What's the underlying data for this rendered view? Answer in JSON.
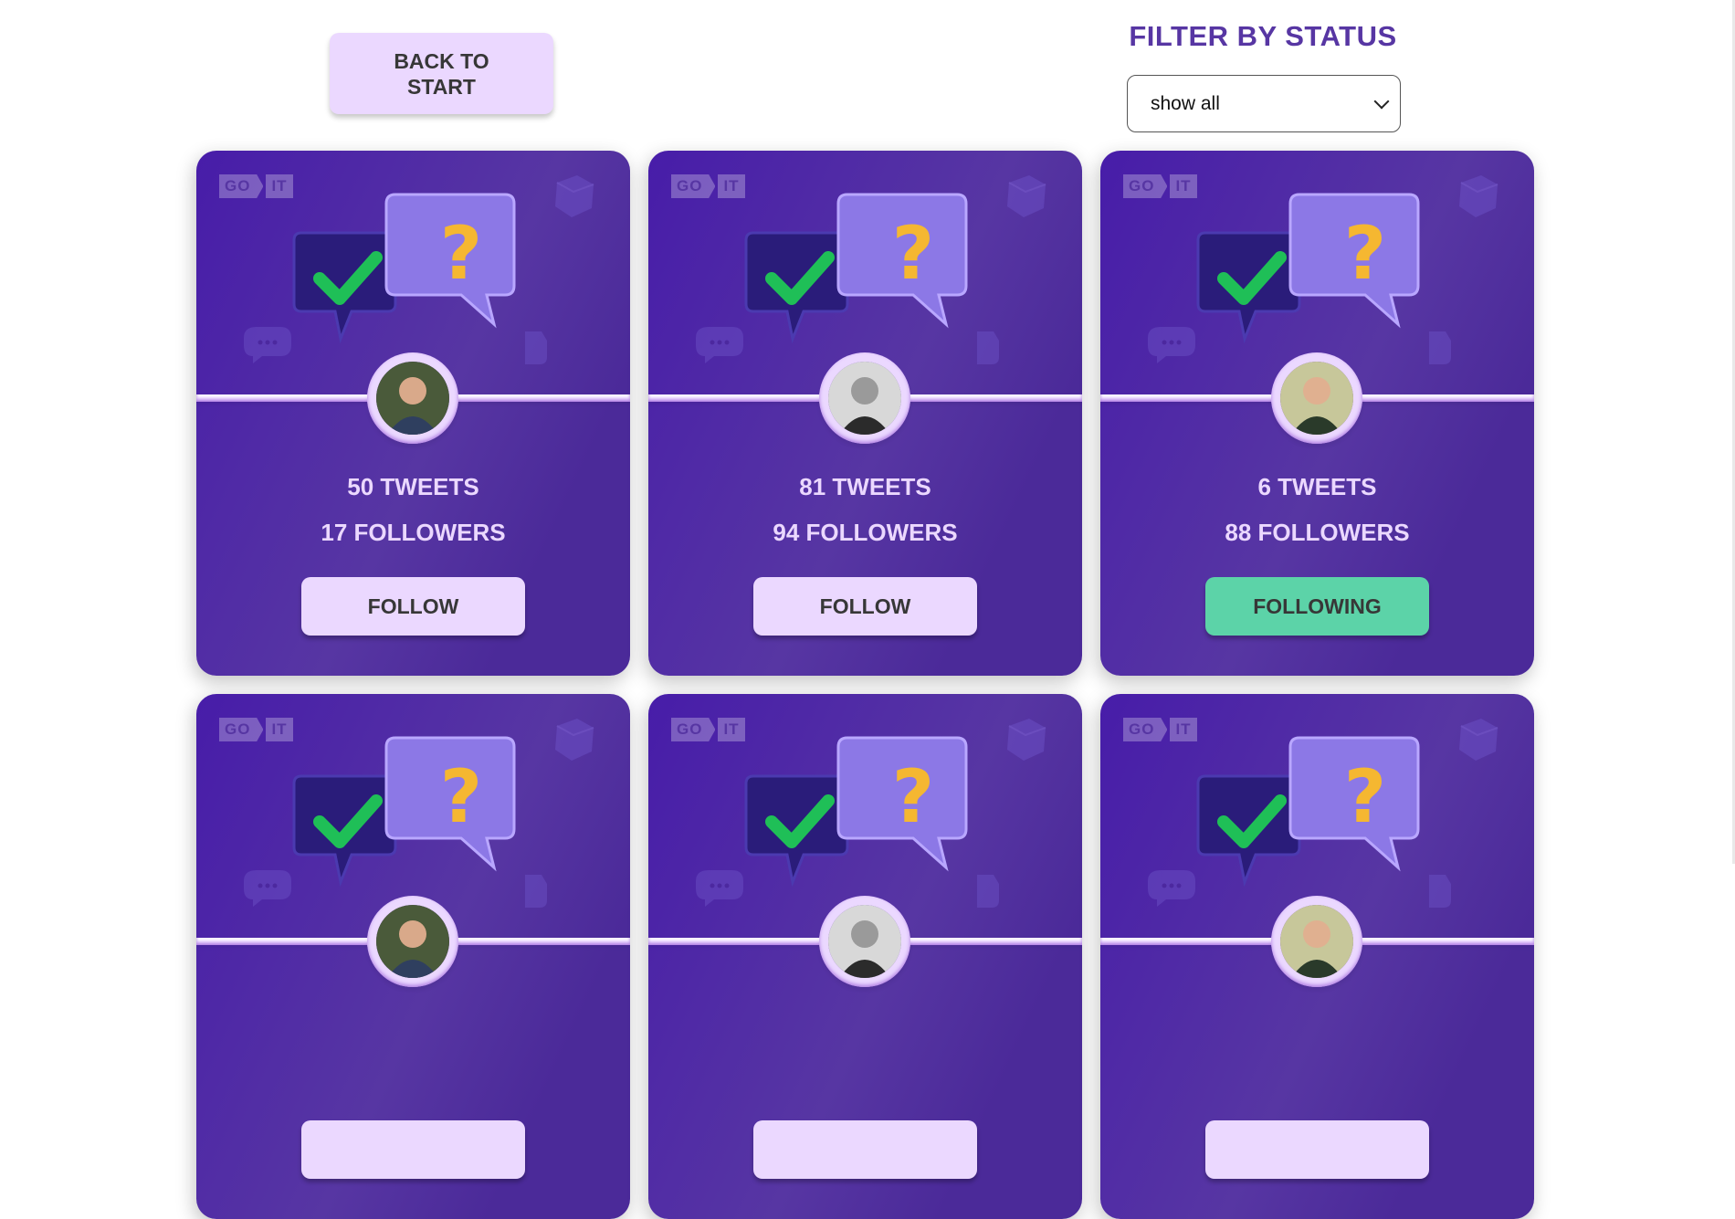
{
  "back_button": {
    "label": "BACK TO START"
  },
  "filter": {
    "title": "FILTER BY STATUS",
    "selected": "show all"
  },
  "logo": {
    "left": "GO",
    "right": "IT"
  },
  "cards": [
    {
      "tweets": "50 TWEETS",
      "followers": "17 FOLLOWERS",
      "button": "FOLLOW",
      "following": false
    },
    {
      "tweets": "81 TWEETS",
      "followers": "94 FOLLOWERS",
      "button": "FOLLOW",
      "following": false
    },
    {
      "tweets": "6 TWEETS",
      "followers": "88 FOLLOWERS",
      "button": "FOLLOWING",
      "following": true
    },
    {
      "tweets": "",
      "followers": "",
      "button": "",
      "following": false
    },
    {
      "tweets": "",
      "followers": "",
      "button": "",
      "following": false
    },
    {
      "tweets": "",
      "followers": "",
      "button": "",
      "following": false
    }
  ],
  "colors": {
    "accent": "#5736a3",
    "button": "#ebd8ff",
    "following": "#5cd3a8",
    "card_start": "#471ca9",
    "card_end": "#4b2a99"
  }
}
